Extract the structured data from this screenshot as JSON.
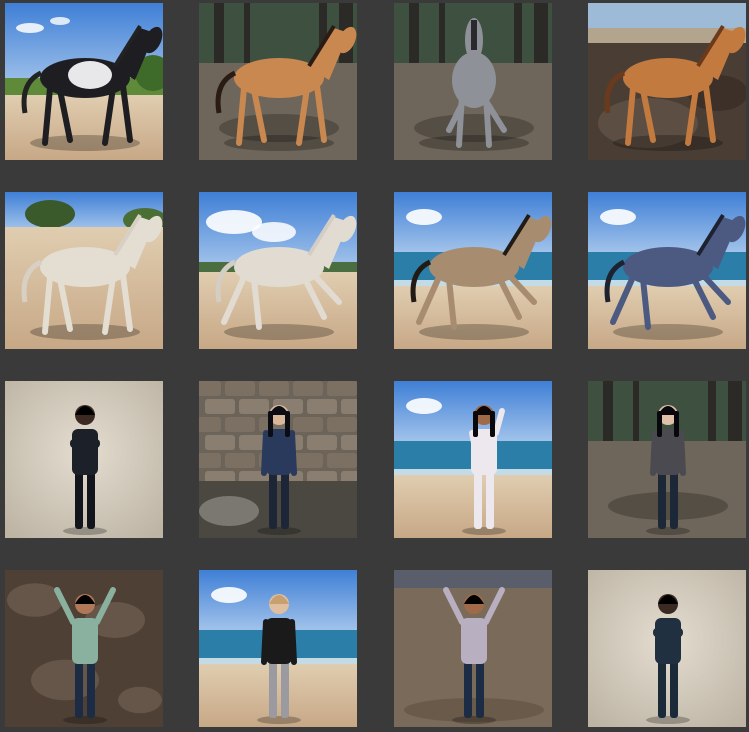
{
  "gallery": {
    "background": "#3a3a3a",
    "thumbnails": [
      {
        "id": "t1",
        "subject": "horse",
        "coat": "#1e1e22",
        "patch": "#e8e8ea",
        "scene": "desert-sky",
        "pose": "rearing"
      },
      {
        "id": "t2",
        "subject": "horse",
        "coat": "#c98850",
        "mane": "#2a1c14",
        "scene": "forest-dirt",
        "pose": "walking"
      },
      {
        "id": "t3",
        "subject": "horse",
        "coat": "#8e9198",
        "mane": "#2a2a2e",
        "scene": "forest-dirt",
        "pose": "front"
      },
      {
        "id": "t4",
        "subject": "horse",
        "coat": "#c27a3f",
        "mane": "#6b3a1c",
        "scene": "rocky-coast",
        "pose": "walking"
      },
      {
        "id": "t5",
        "subject": "horse",
        "coat": "#e4ddd2",
        "mane": "#d8d0c4",
        "scene": "beach-trees",
        "pose": "trotting"
      },
      {
        "id": "t6",
        "subject": "horse",
        "coat": "#e1dbd1",
        "mane": "#d4cdc3",
        "scene": "beach-sky",
        "pose": "galloping"
      },
      {
        "id": "t7",
        "subject": "horse",
        "coat": "#a88c70",
        "mane": "#221a15",
        "scene": "beach-sea",
        "pose": "galloping"
      },
      {
        "id": "t8",
        "subject": "horse",
        "coat": "#4c5a82",
        "mane": "#1e2230",
        "scene": "beach-sea",
        "pose": "galloping"
      },
      {
        "id": "t9",
        "subject": "person",
        "skin": "#3a2a22",
        "top": "#1c2028",
        "legs": "#12161c",
        "hair": "#000000",
        "scene": "blank-studio",
        "pose": "arms-crossed"
      },
      {
        "id": "t10",
        "subject": "person",
        "skin": "#d9b89a",
        "top": "#2a3a5c",
        "legs": "#1c2636",
        "hair": "#0c0c14",
        "scene": "stone-ruins",
        "pose": "side"
      },
      {
        "id": "t11",
        "subject": "person",
        "skin": "#a06a48",
        "top": "#ece8ee",
        "legs": "#ece8ee",
        "hair": "#0c0808",
        "scene": "beach-sea",
        "pose": "hand-up"
      },
      {
        "id": "t12",
        "subject": "person",
        "skin": "#e0c0a8",
        "top": "#4a4a50",
        "legs": "#1c2838",
        "hair": "#08080c",
        "scene": "forest-dirt",
        "pose": "standing"
      },
      {
        "id": "t13",
        "subject": "person",
        "skin": "#b07858",
        "top": "#8ab0a0",
        "legs": "#1c2c44",
        "hair": "#000000",
        "scene": "rocky-ground",
        "pose": "waving"
      },
      {
        "id": "t14",
        "subject": "person",
        "skin": "#e0bfa0",
        "top": "#1a1a1a",
        "legs": "#9a9aa0",
        "hair": "#c8a070",
        "scene": "beach-sea",
        "pose": "standing"
      },
      {
        "id": "t15",
        "subject": "person",
        "skin": "#a06a48",
        "top": "#b8b0c0",
        "legs": "#1c2c44",
        "hair": "#000000",
        "scene": "desert-sand",
        "pose": "arms-raised"
      },
      {
        "id": "t16",
        "subject": "person",
        "skin": "#3a2a22",
        "top": "#203040",
        "legs": "#1a2a38",
        "hair": "#000000",
        "scene": "blank-studio",
        "pose": "arms-crossed"
      }
    ]
  }
}
